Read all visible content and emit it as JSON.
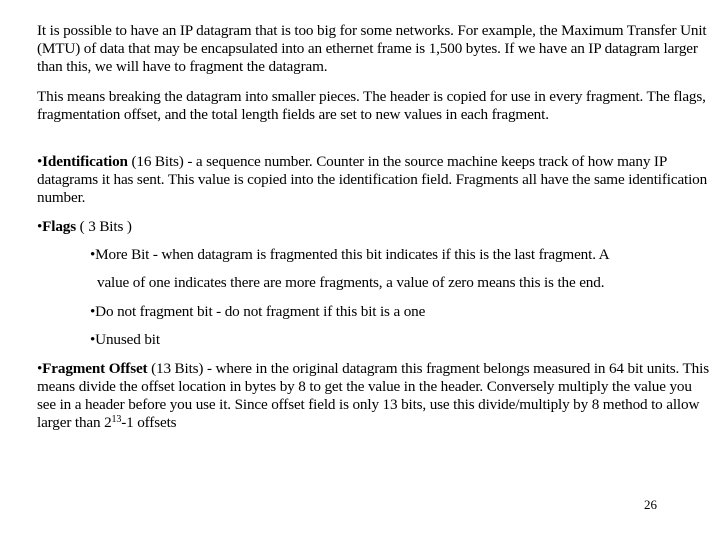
{
  "slide": {
    "paragraphs": [
      {
        "text": "It is possible to have an IP datagram that is too big for some networks. For example, the Maximum Transfer Unit (MTU) of data that may be encapsulated into an ethernet frame is 1,500 bytes. If we have an IP datagram larger than this, we will have to fragment the datagram."
      },
      {
        "text": "This means breaking the datagram into smaller pieces. The header is copied for use in every fragment. The flags, fragmentation offset, and the total length fields are set to new values in each fragment."
      }
    ],
    "identification": {
      "bullet": "•",
      "term": "Identification",
      "text": " (16 Bits) - a sequence number. Counter in the source machine keeps track of how many IP datagrams it has sent. This value is copied into the identification field. Fragments all have the same identification number."
    },
    "flags": {
      "bullet": "•",
      "term": "Flags",
      "text": " ( 3 Bits )",
      "sub_items": [
        {
          "text": "•More Bit - when datagram is fragmented this bit indicates if this is the last fragment. A"
        },
        {
          "text": "value of one indicates there are more fragments, a value of zero means this is the end."
        },
        {
          "text": "•Do not fragment bit - do not fragment if this bit is a one"
        },
        {
          "text": "•Unused bit"
        }
      ]
    },
    "fragment_offset": {
      "bullet": "•",
      "term": "Fragment Offset",
      "text": " (13 Bits) - where in the original datagram this fragment belongs measured in 64 bit units. This means divide the offset location in bytes by 8 to get the value in the header. Conversely multiply the value you see in a header before you use it. Since offset field is only 13 bits, use this divide/multiply by 8 method to allow larger than 2",
      "superscript": "13",
      "suffix": "-1 offsets"
    },
    "page_number": "26"
  }
}
